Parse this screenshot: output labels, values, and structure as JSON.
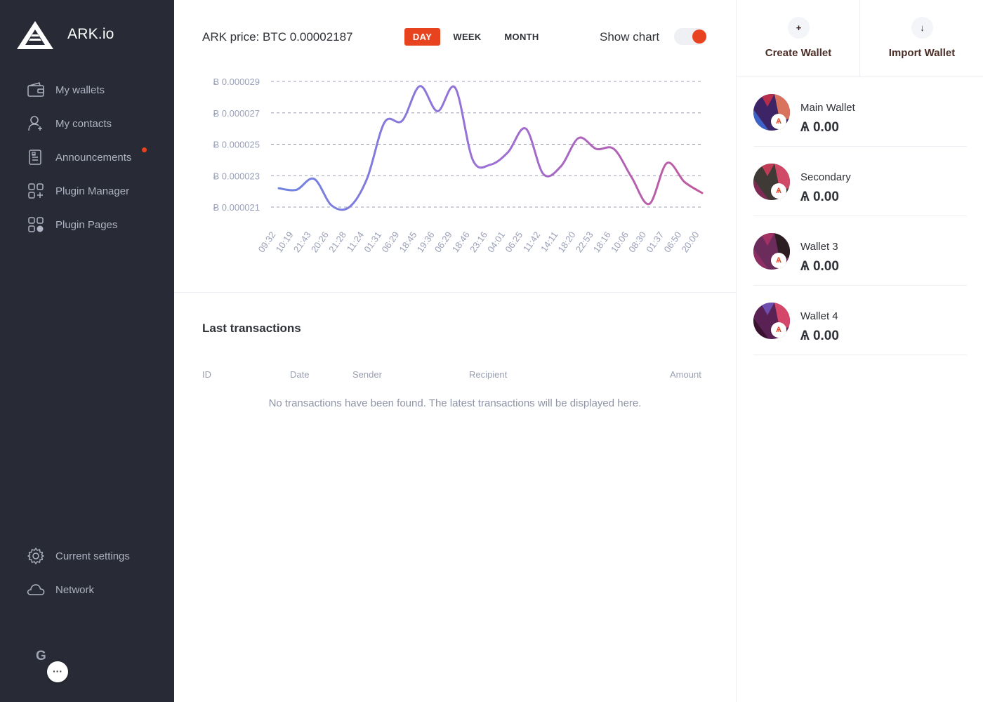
{
  "brand": {
    "name": "ARK.io"
  },
  "sidebar": {
    "items": [
      {
        "label": "My wallets",
        "icon": "wallet-icon"
      },
      {
        "label": "My contacts",
        "icon": "contact-icon"
      },
      {
        "label": "Announcements",
        "icon": "announcement-icon",
        "has_notification": true
      },
      {
        "label": "Plugin Manager",
        "icon": "plugin-manager-icon"
      },
      {
        "label": "Plugin Pages",
        "icon": "plugin-pages-icon"
      }
    ],
    "bottom_items": [
      {
        "label": "Current settings",
        "icon": "gear-icon"
      },
      {
        "label": "Network",
        "icon": "cloud-icon"
      }
    ],
    "profile": {
      "initial": "G",
      "menu_glyph": "···"
    }
  },
  "price": {
    "title": "ARK price: BTC 0.00002187",
    "periods": [
      "DAY",
      "WEEK",
      "MONTH"
    ],
    "active_period": "DAY",
    "show_chart_label": "Show chart",
    "show_chart_enabled": true
  },
  "chart_data": {
    "type": "line",
    "title": "",
    "xlabel": "",
    "ylabel": "",
    "ylim": [
      2.1e-05,
      2.9e-05
    ],
    "y_ticks": [
      "Ƀ 0.000029",
      "Ƀ 0.000027",
      "Ƀ 0.000025",
      "Ƀ 0.000023",
      "Ƀ 0.000021"
    ],
    "y_tick_values": [
      2.9e-05,
      2.7e-05,
      2.5e-05,
      2.3e-05,
      2.1e-05
    ],
    "x": [
      "09:32",
      "10:19",
      "21:43",
      "20:26",
      "21:28",
      "11:24",
      "01:31",
      "06:29",
      "18:45",
      "19:36",
      "06:29",
      "18:46",
      "23:16",
      "04:01",
      "06:25",
      "11:42",
      "14:11",
      "18:20",
      "22:53",
      "18:16",
      "10:06",
      "08:30",
      "01:37",
      "06:50",
      "20:00"
    ],
    "series": [
      {
        "values": [
          2.22e-05,
          2.21e-05,
          2.28e-05,
          2.11e-05,
          2.1e-05,
          2.28e-05,
          2.64e-05,
          2.65e-05,
          2.87e-05,
          2.71e-05,
          2.86e-05,
          2.4e-05,
          2.37e-05,
          2.45e-05,
          2.6e-05,
          2.31e-05,
          2.36e-05,
          2.54e-05,
          2.47e-05,
          2.47e-05,
          2.29e-05,
          2.12e-05,
          2.38e-05,
          2.26e-05,
          2.19e-05
        ],
        "color_start": "#6f83e0",
        "color_mid": "#9b6fd6",
        "color_end": "#c15a9e"
      }
    ],
    "grid": true,
    "grid_style": "dashed"
  },
  "transactions": {
    "title": "Last transactions",
    "columns": [
      "ID",
      "Date",
      "Sender",
      "Recipient",
      "Amount"
    ],
    "empty_message": "No transactions have been found. The latest transactions will be displayed here."
  },
  "actions": {
    "create": {
      "label": "Create Wallet",
      "icon_glyph": "+"
    },
    "import": {
      "label": "Import Wallet",
      "icon_glyph": "↓"
    }
  },
  "wallets": [
    {
      "name": "Main Wallet",
      "balance": "Ѧ 0.00",
      "colors": [
        "#3c2466",
        "#d9735e",
        "#3d63c8",
        "#b62e4b"
      ]
    },
    {
      "name": "Secondary",
      "balance": "Ѧ 0.00",
      "colors": [
        "#3f3a35",
        "#d04a68",
        "#7d2a55",
        "#c03c55"
      ]
    },
    {
      "name": "Wallet 3",
      "balance": "Ѧ 0.00",
      "colors": [
        "#6b2b5b",
        "#2c1d22",
        "#8c2e64",
        "#a43164"
      ]
    },
    {
      "name": "Wallet 4",
      "balance": "Ѧ 0.00",
      "colors": [
        "#5a2154",
        "#d5476a",
        "#3a1230",
        "#6e4db0"
      ]
    }
  ],
  "badge_glyph": "Ѧ",
  "colors": {
    "accent": "#e8431f",
    "sidebar_bg": "#282b35",
    "sidebar_text": "#aeb2c2"
  }
}
